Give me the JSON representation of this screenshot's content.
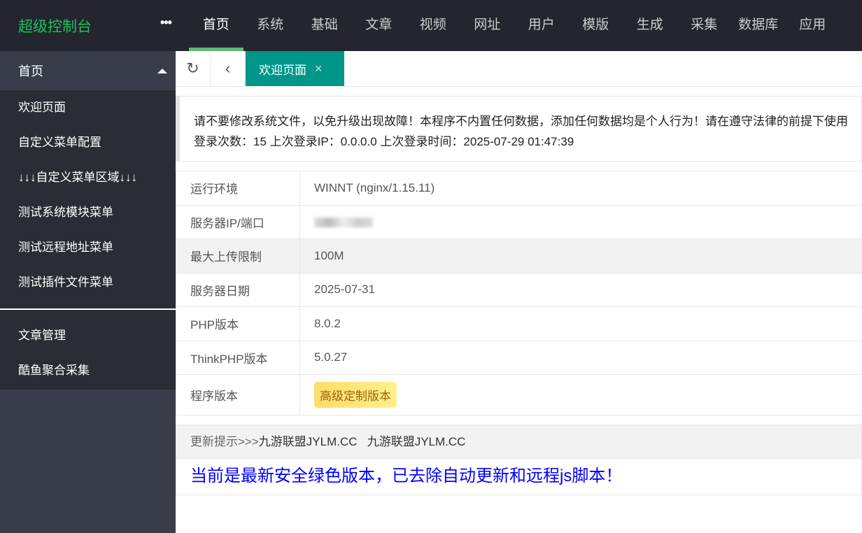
{
  "header": {
    "logo": "超级控制台",
    "more": "•••",
    "nav": [
      "首页",
      "系统",
      "基础",
      "文章",
      "视频",
      "网址",
      "用户",
      "模版",
      "生成",
      "采集",
      "数据库",
      "应用"
    ]
  },
  "sidebar": {
    "section": "首页",
    "items": [
      "欢迎页面",
      "自定义菜单配置",
      "↓↓↓自定义菜单区域↓↓↓",
      "测试系统模块菜单",
      "测试远程地址菜单",
      "测试插件文件菜单"
    ],
    "items2": [
      "文章管理",
      "酷鱼聚合采集"
    ]
  },
  "tabs": {
    "active": "欢迎页面",
    "close": "×"
  },
  "notice": {
    "line1": "请不要修改系统文件，以免升级出现故障！本程序不内置任何数据，添加任何数据均是个人行为！请在遵守法律的前提下使用",
    "line2": "登录次数：15 上次登录IP：0.0.0.0 上次登录时间：2025-07-29 01:47:39"
  },
  "info": [
    {
      "label": "运行环境",
      "value": "WINNT (nginx/1.15.11)"
    },
    {
      "label": "服务器IP/端口",
      "value": ""
    },
    {
      "label": "最大上传限制",
      "value": "100M"
    },
    {
      "label": "服务器日期",
      "value": "2025-07-31"
    },
    {
      "label": "PHP版本",
      "value": "8.0.2"
    },
    {
      "label": "ThinkPHP版本",
      "value": "5.0.27"
    },
    {
      "label": "程序版本",
      "value": "高级定制版本"
    }
  ],
  "update": {
    "prefix": "更新提示>>>",
    "link1": "九游联盟JYLM.CC",
    "link2": "九游联盟JYLM.CC",
    "message": "当前是最新安全绿色版本，已去除自动更新和远程js脚本！"
  }
}
